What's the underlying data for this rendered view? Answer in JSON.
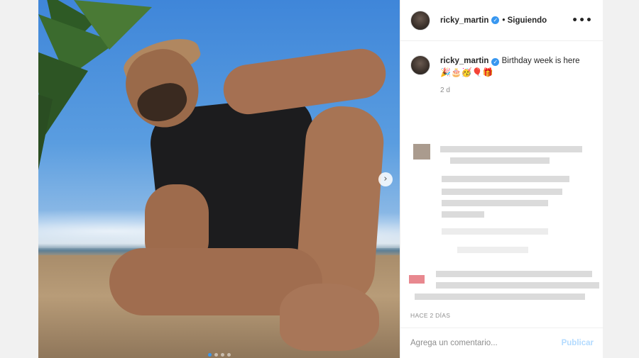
{
  "header": {
    "username": "ricky_martin",
    "verified_mark": "✓",
    "follow_status": "• Siguiendo",
    "more_menu": "•••"
  },
  "caption": {
    "username": "ricky_martin",
    "verified_mark": "✓",
    "text": "Birthday week is here",
    "emojis": "🎉🎂🥳🎈🎁",
    "age": "2 d"
  },
  "post": {
    "timestamp": "HACE 2 DÍAS",
    "carousel_next": "›",
    "carousel_slides": 4,
    "carousel_active_index": 0
  },
  "comment_bar": {
    "placeholder": "Agrega un comentario...",
    "publish_label": "Publicar"
  },
  "colors": {
    "accent": "#3897f0",
    "publish_disabled": "#b3dbff",
    "text_primary": "#262626",
    "text_secondary": "#8e8e8e"
  }
}
